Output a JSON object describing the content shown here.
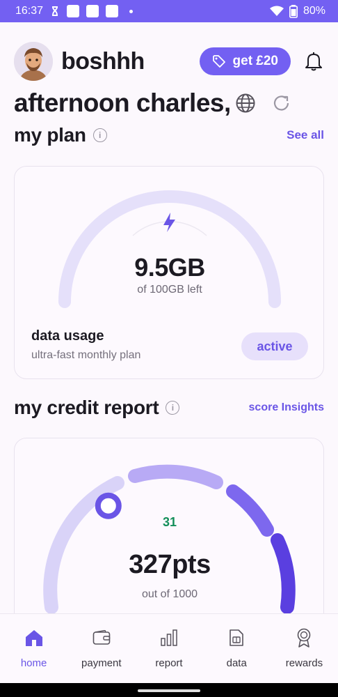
{
  "status_bar": {
    "time": "16:37",
    "battery": "80%"
  },
  "header": {
    "brand": "boshhh",
    "promo_label": "get £20"
  },
  "greeting": "afternoon charles,",
  "plan_section": {
    "title": "my plan",
    "link": "See all",
    "gauge": {
      "value": "9.5GB",
      "caption": "of 100GB left",
      "remaining_fraction": 0.095
    },
    "name": "data usage",
    "description": "ultra-fast monthly plan",
    "status": "active"
  },
  "credit_section": {
    "title": "my credit report",
    "link": "score Insights",
    "score_change": "31",
    "score": "327pts",
    "score_caption": "out of 1000",
    "score_fraction": 0.327
  },
  "bottom_nav": {
    "items": [
      {
        "label": "home",
        "icon": "home-icon"
      },
      {
        "label": "payment",
        "icon": "wallet-icon"
      },
      {
        "label": "report",
        "icon": "bar-chart-icon"
      },
      {
        "label": "data",
        "icon": "sim-card-icon"
      },
      {
        "label": "rewards",
        "icon": "award-icon"
      }
    ]
  },
  "colors": {
    "accent": "#7360f2",
    "accent_dark": "#5a3fe0",
    "positive": "#148f5a",
    "gauge_track": "#e5e0fa"
  }
}
